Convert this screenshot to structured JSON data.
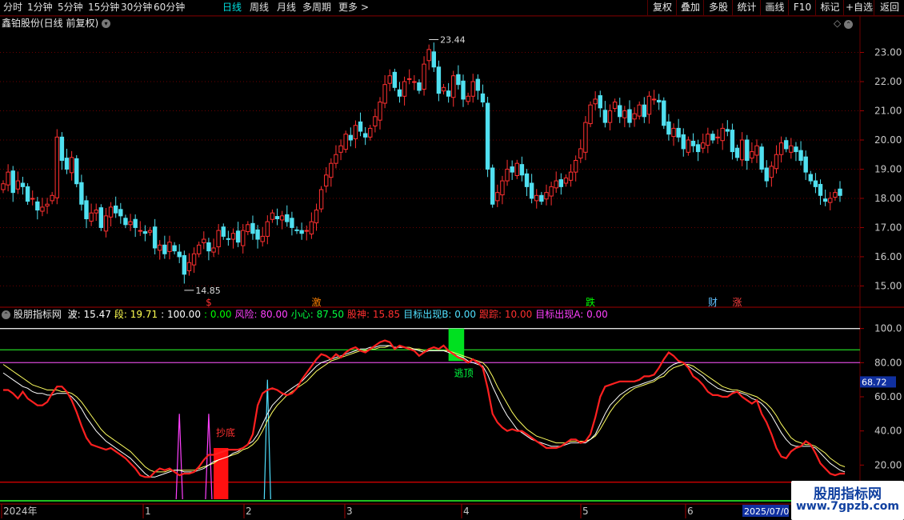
{
  "toolbar": {
    "periods": [
      "分时",
      "1分钟",
      "5分钟",
      "15分钟",
      "30分钟",
      "60分钟",
      "日线",
      "周线",
      "月线",
      "多周期",
      "更多"
    ],
    "active_period": "日线",
    "more_arrow": ">",
    "right_buttons": [
      "复权",
      "叠加",
      "多股",
      "统计",
      "画线",
      "F10",
      "标记",
      "+自选",
      "返回"
    ]
  },
  "main": {
    "title": "鑫铂股份(日线 前复权)",
    "high_label": "23.44",
    "low_label": "14.85",
    "price_ticks": [
      "23.00",
      "22.00",
      "21.00",
      "20.00",
      "19.00",
      "18.00",
      "17.00",
      "16.00",
      "15.00"
    ]
  },
  "markers": [
    {
      "text": "$",
      "color": "#ff3030"
    },
    {
      "text": "激",
      "color": "#ff8000"
    },
    {
      "text": "跌",
      "color": "#00ff00"
    },
    {
      "text": "财",
      "color": "#60c0ff"
    },
    {
      "text": "涨",
      "color": "#ff4040"
    }
  ],
  "indicator": {
    "title": "股朋指标网",
    "values": [
      {
        "label": "波: ",
        "value": "15.47",
        "color": "#ffffff"
      },
      {
        "label": "段: ",
        "value": "19.71",
        "color": "#ffff50"
      },
      {
        "label": ": ",
        "value": "100.00",
        "color": "#ffffff"
      },
      {
        "label": ": ",
        "value": "0.00",
        "color": "#00ff00"
      },
      {
        "label": "风险: ",
        "value": "80.00",
        "color": "#ff40ff"
      },
      {
        "label": "小心: ",
        "value": "87.50",
        "color": "#00ff40"
      },
      {
        "label": "股神: ",
        "value": "15.85",
        "color": "#ff3030"
      },
      {
        "label": "目标出现B: ",
        "value": "0.00",
        "color": "#50e0ff"
      },
      {
        "label": "跟踪: ",
        "value": "10.00",
        "color": "#ff3030"
      },
      {
        "label": "目标出现A: ",
        "value": "0.00",
        "color": "#ff40ff"
      }
    ],
    "ticks": [
      "100.0",
      "80.00",
      "60.00",
      "40.00",
      "20.00"
    ],
    "current_value": "68.72",
    "escape_top_label": "逃顶",
    "bottom_buy_label": "抄底"
  },
  "time_axis": {
    "labels": [
      "2024年",
      "1",
      "2",
      "3",
      "4",
      "5",
      "6"
    ],
    "current_date": "2025/07/0"
  },
  "watermark": {
    "line1": "股朋指标网",
    "line2": "www.7gpzb.com"
  },
  "colors": {
    "up": "#ff3030",
    "down": "#50e0f0",
    "grid": "#6a0000",
    "text": "#c8c8c8"
  },
  "chart_data": {
    "type": "candlestick",
    "price_range": [
      14.6,
      23.7
    ],
    "closes": [
      18.5,
      18.9,
      18.2,
      18.6,
      18.4,
      17.9,
      18.0,
      17.6,
      17.7,
      17.8,
      18.1,
      20.1,
      19.3,
      19.0,
      19.4,
      18.5,
      17.8,
      17.3,
      17.5,
      17.6,
      17.0,
      17.4,
      17.7,
      17.5,
      17.4,
      17.1,
      17.2,
      17.0,
      16.9,
      16.8,
      16.9,
      16.3,
      16.4,
      16.1,
      16.5,
      16.2,
      16.0,
      15.4,
      15.8,
      16.1,
      16.4,
      16.6,
      16.2,
      16.3,
      16.9,
      16.7,
      16.6,
      16.8,
      16.5,
      16.9,
      17.1,
      16.8,
      16.6,
      16.7,
      17.2,
      17.5,
      17.3,
      17.4,
      17.2,
      17.0,
      16.9,
      16.8,
      16.9,
      17.2,
      17.6,
      18.3,
      18.8,
      19.2,
      19.5,
      19.8,
      20.2,
      20.0,
      20.5,
      20.3,
      20.1,
      20.4,
      20.8,
      21.3,
      21.9,
      22.2,
      21.8,
      21.5,
      22.0,
      22.1,
      22.0,
      21.7,
      22.6,
      23.1,
      22.5,
      21.6,
      21.8,
      21.5,
      22.2,
      21.9,
      21.4,
      21.5,
      22.0,
      21.7,
      21.3,
      19.0,
      17.8,
      18.2,
      18.6,
      19.0,
      18.9,
      19.2,
      18.8,
      18.4,
      18.0,
      18.1,
      17.9,
      18.2,
      18.4,
      18.6,
      18.4,
      18.7,
      18.9,
      19.3,
      19.7,
      20.6,
      21.2,
      21.4,
      21.1,
      20.6,
      21.0,
      21.3,
      20.8,
      21.0,
      20.6,
      20.9,
      21.2,
      20.8,
      21.5,
      21.4,
      21.3,
      20.5,
      20.2,
      20.4,
      20.1,
      19.7,
      20.0,
      19.8,
      19.6,
      19.9,
      20.2,
      20.0,
      20.1,
      20.4,
      20.3,
      19.6,
      19.4,
      20.0,
      19.3,
      19.6,
      19.8,
      19.0,
      18.6,
      19.1,
      19.5,
      19.9,
      19.7,
      19.8,
      19.6,
      19.3,
      18.9,
      18.6,
      18.4,
      18.1,
      17.9,
      18.0,
      18.2,
      18.1
    ],
    "osc": {
      "range": [
        0,
        105
      ],
      "gushen": [
        64,
        64,
        62,
        59,
        63,
        59,
        57,
        55,
        55,
        57,
        62,
        66,
        66,
        63,
        58,
        51,
        43,
        36,
        32,
        31,
        30,
        29,
        30,
        28,
        26,
        24,
        21,
        18,
        14,
        13,
        13,
        16,
        18,
        17,
        18,
        16,
        14,
        15,
        15,
        16,
        19,
        23,
        26,
        26,
        27,
        28,
        29,
        29,
        29,
        30,
        32,
        38,
        55,
        62,
        64,
        65,
        64,
        62,
        61,
        62,
        65,
        70,
        74,
        78,
        82,
        85,
        84,
        82,
        85,
        83,
        86,
        88,
        89,
        87,
        86,
        88,
        90,
        92,
        93,
        92,
        88,
        90,
        89,
        88,
        87,
        84,
        86,
        88,
        89,
        88,
        90,
        87,
        85,
        83,
        82,
        80,
        82,
        80,
        77,
        65,
        50,
        45,
        42,
        40,
        41,
        40,
        40,
        38,
        36,
        34,
        32,
        30,
        30,
        30,
        31,
        33,
        35,
        35,
        33,
        34,
        38,
        48,
        60,
        66,
        67,
        68,
        69,
        69,
        69,
        69,
        70,
        72,
        72,
        73,
        77,
        82,
        86,
        84,
        81,
        80,
        77,
        72,
        70,
        67,
        63,
        61,
        61,
        60,
        60,
        62,
        63,
        60,
        58,
        56,
        58,
        50,
        45,
        38,
        30,
        25,
        24,
        28,
        30,
        31,
        34,
        32,
        27,
        21,
        18,
        15,
        14,
        15,
        15
      ],
      "wave": [
        74,
        72,
        70,
        68,
        66,
        65,
        63,
        62,
        62,
        61,
        61,
        62,
        62,
        62,
        60,
        57,
        53,
        48,
        44,
        40,
        37,
        34,
        32,
        30,
        28,
        26,
        24,
        21,
        18,
        15,
        13,
        13,
        14,
        15,
        16,
        17,
        17,
        16,
        16,
        16,
        17,
        18,
        20,
        22,
        23,
        24,
        25,
        27,
        28,
        30,
        32,
        34,
        38,
        44,
        50,
        55,
        58,
        61,
        63,
        65,
        67,
        69,
        72,
        75,
        78,
        80,
        81,
        82,
        83,
        84,
        85,
        86,
        87,
        88,
        88,
        89,
        89,
        90,
        90,
        90,
        89,
        89,
        89,
        88,
        88,
        87,
        86,
        87,
        87,
        87,
        87,
        86,
        85,
        84,
        83,
        81,
        80,
        79,
        78,
        73,
        66,
        60,
        54,
        49,
        45,
        41,
        39,
        37,
        35,
        34,
        33,
        32,
        31,
        31,
        31,
        32,
        33,
        33,
        33,
        33,
        35,
        38,
        44,
        50,
        55,
        58,
        61,
        63,
        65,
        66,
        67,
        68,
        69,
        70,
        72,
        74,
        77,
        79,
        80,
        80,
        78,
        76,
        74,
        72,
        69,
        67,
        65,
        64,
        63,
        63,
        63,
        62,
        61,
        59,
        58,
        56,
        53,
        49,
        44,
        39,
        35,
        32,
        31,
        31,
        31,
        31,
        30,
        27,
        24,
        21,
        19,
        17,
        16
      ],
      "segment": [
        79,
        77,
        75,
        73,
        71,
        69,
        67,
        66,
        65,
        64,
        64,
        64,
        63,
        63,
        62,
        60,
        57,
        53,
        49,
        45,
        41,
        38,
        36,
        34,
        32,
        30,
        28,
        25,
        22,
        19,
        17,
        16,
        16,
        16,
        17,
        17,
        17,
        17,
        17,
        17,
        18,
        19,
        20,
        21,
        23,
        24,
        25,
        26,
        27,
        29,
        30,
        32,
        35,
        40,
        46,
        51,
        55,
        58,
        61,
        63,
        65,
        67,
        69,
        72,
        75,
        77,
        79,
        81,
        82,
        83,
        84,
        85,
        86,
        87,
        87,
        88,
        88,
        89,
        89,
        90,
        89,
        89,
        89,
        89,
        88,
        88,
        87,
        87,
        87,
        87,
        87,
        87,
        86,
        85,
        84,
        83,
        82,
        81,
        80,
        77,
        72,
        66,
        61,
        56,
        51,
        47,
        44,
        41,
        39,
        37,
        36,
        35,
        34,
        33,
        33,
        33,
        34,
        34,
        34,
        34,
        35,
        37,
        41,
        46,
        51,
        55,
        58,
        61,
        63,
        65,
        66,
        67,
        68,
        69,
        71,
        72,
        75,
        77,
        78,
        79,
        79,
        78,
        76,
        74,
        72,
        70,
        68,
        66,
        65,
        64,
        64,
        63,
        62,
        61,
        60,
        58,
        56,
        53,
        49,
        44,
        40,
        36,
        34,
        33,
        32,
        32,
        31,
        29,
        27,
        24,
        22,
        20,
        19
      ]
    }
  }
}
